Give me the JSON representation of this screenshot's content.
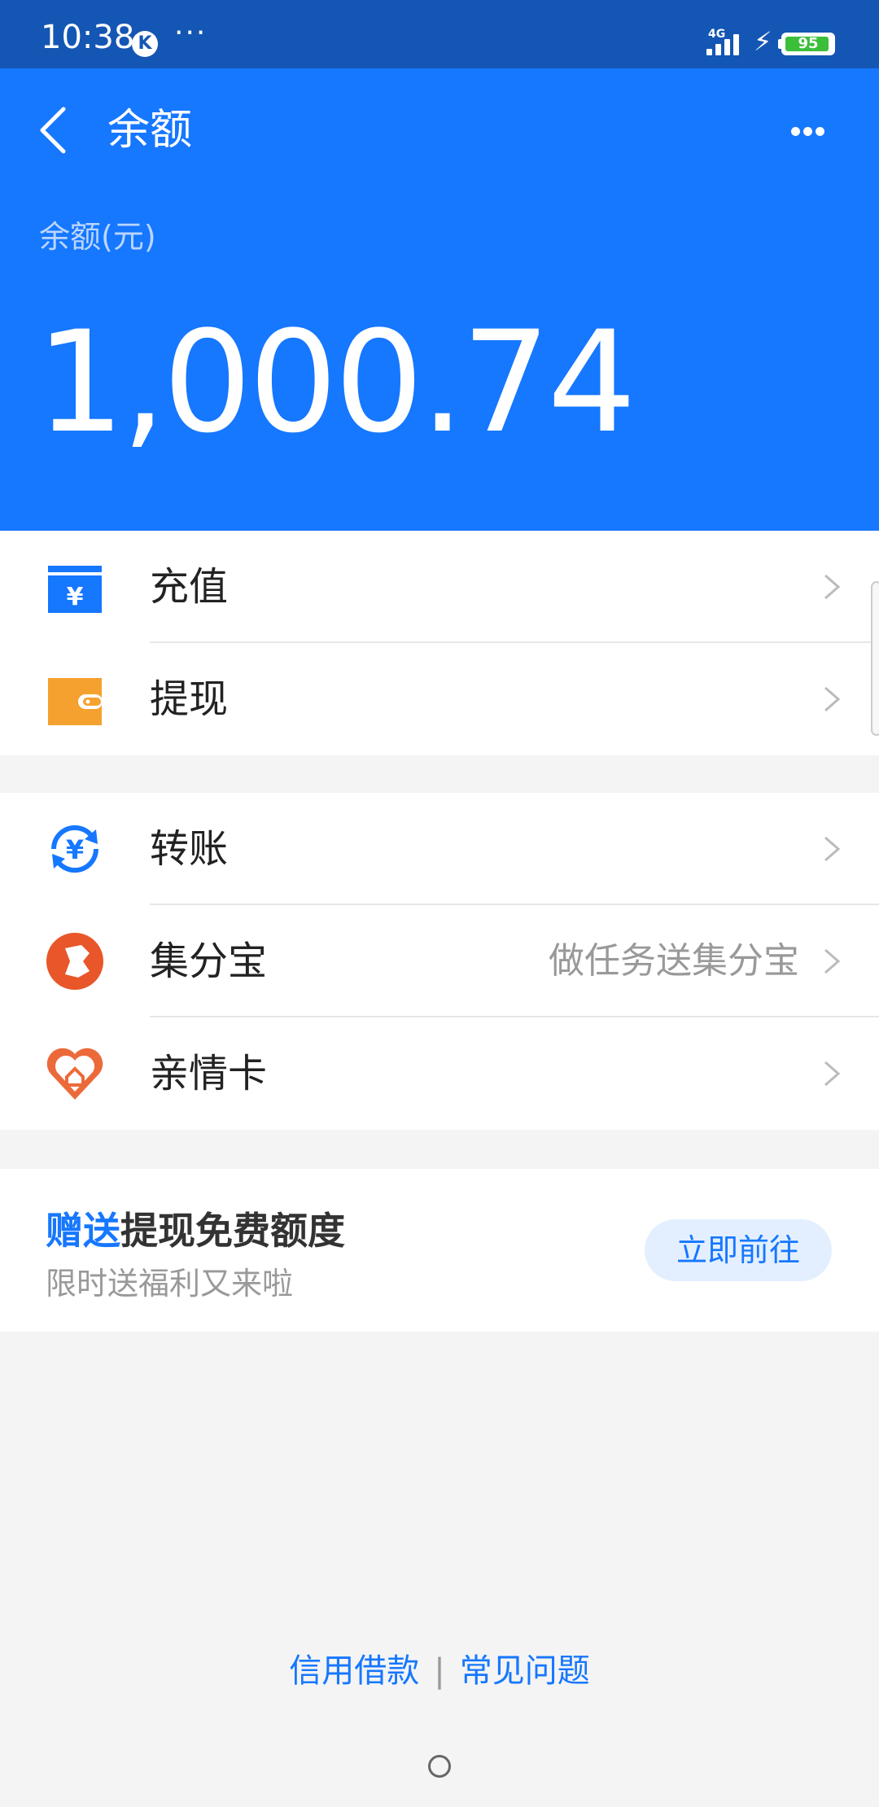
{
  "status_bar": {
    "time": "10:38",
    "badge": "K",
    "dots": "···",
    "network": "4G",
    "battery_level": "95",
    "battery_percent": 95
  },
  "header": {
    "title": "余额",
    "balance_label": "余额(元)",
    "balance_amount": "1,000.74"
  },
  "groups": [
    {
      "items": [
        {
          "label": "充值",
          "icon": "recharge-icon"
        },
        {
          "label": "提现",
          "icon": "wallet-icon"
        }
      ]
    },
    {
      "items": [
        {
          "label": "转账",
          "icon": "transfer-icon"
        },
        {
          "label": "集分宝",
          "icon": "jifenbao-icon",
          "subtitle": "做任务送集分宝"
        },
        {
          "label": "亲情卡",
          "icon": "family-card-icon"
        }
      ]
    }
  ],
  "promo": {
    "title_highlight": "赠送",
    "title_rest": "提现免费额度",
    "subtitle": "限时送福利又来啦",
    "button": "立即前往"
  },
  "footer": {
    "link1": "信用借款",
    "separator": "|",
    "link2": "常见问题"
  },
  "colors": {
    "status_bar": "#1456b3",
    "header": "#1677ff",
    "accent": "#1677ff",
    "wallet": "#f5a130",
    "jifenbao": "#e8562a"
  }
}
